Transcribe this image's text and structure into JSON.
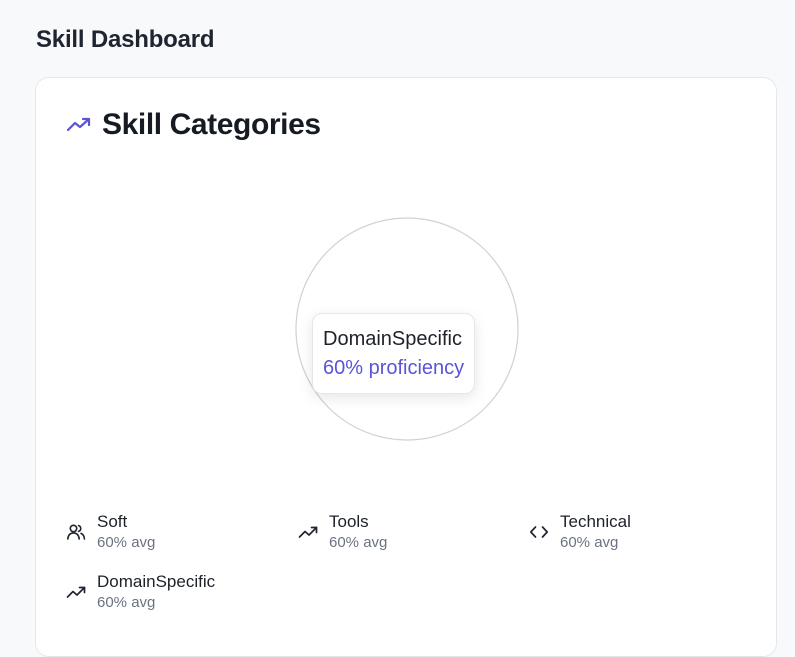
{
  "page": {
    "title": "Skill Dashboard"
  },
  "card": {
    "title": "Skill Categories",
    "title_icon": "trending-up-icon",
    "accent_color": "#5b54d6"
  },
  "chart": {
    "type": "pie",
    "tooltip": {
      "name": "DomainSpecific",
      "value": "60% proficiency"
    }
  },
  "legend": {
    "items": [
      {
        "name": "Soft",
        "avg": "60% avg",
        "icon": "users-icon"
      },
      {
        "name": "Tools",
        "avg": "60% avg",
        "icon": "trending-up-icon"
      },
      {
        "name": "Technical",
        "avg": "60% avg",
        "icon": "code-icon"
      },
      {
        "name": "DomainSpecific",
        "avg": "60% avg",
        "icon": "trending-up-icon"
      }
    ]
  },
  "chart_data": {
    "type": "pie",
    "categories": [
      "Soft",
      "Tools",
      "Technical",
      "DomainSpecific"
    ],
    "values": [
      60,
      60,
      60,
      60
    ],
    "title": "Skill Categories"
  }
}
